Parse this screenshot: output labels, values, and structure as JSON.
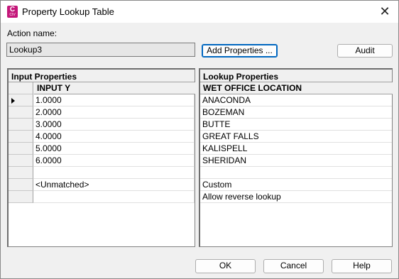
{
  "window": {
    "title": "Property Lookup Table",
    "app_icon_letter": "C",
    "app_icon_sub": "CIV"
  },
  "action": {
    "label": "Action name:",
    "value": "Lookup3"
  },
  "buttons": {
    "add_properties": "Add Properties ...",
    "audit": "Audit",
    "ok": "OK",
    "cancel": "Cancel",
    "help": "Help"
  },
  "input_panel": {
    "caption": "Input Properties",
    "column": "INPUT Y",
    "rows": [
      "1.0000",
      "2.0000",
      "3.0000",
      "4.0000",
      "5.0000",
      "6.0000",
      "",
      "<Unmatched>",
      ""
    ]
  },
  "lookup_panel": {
    "caption": "Lookup Properties",
    "column": "WET OFFICE LOCATION",
    "rows": [
      "ANACONDA",
      "BOZEMAN",
      "BUTTE",
      "GREAT FALLS",
      "KALISPELL",
      "SHERIDAN",
      "",
      "Custom",
      "Allow reverse lookup"
    ]
  }
}
